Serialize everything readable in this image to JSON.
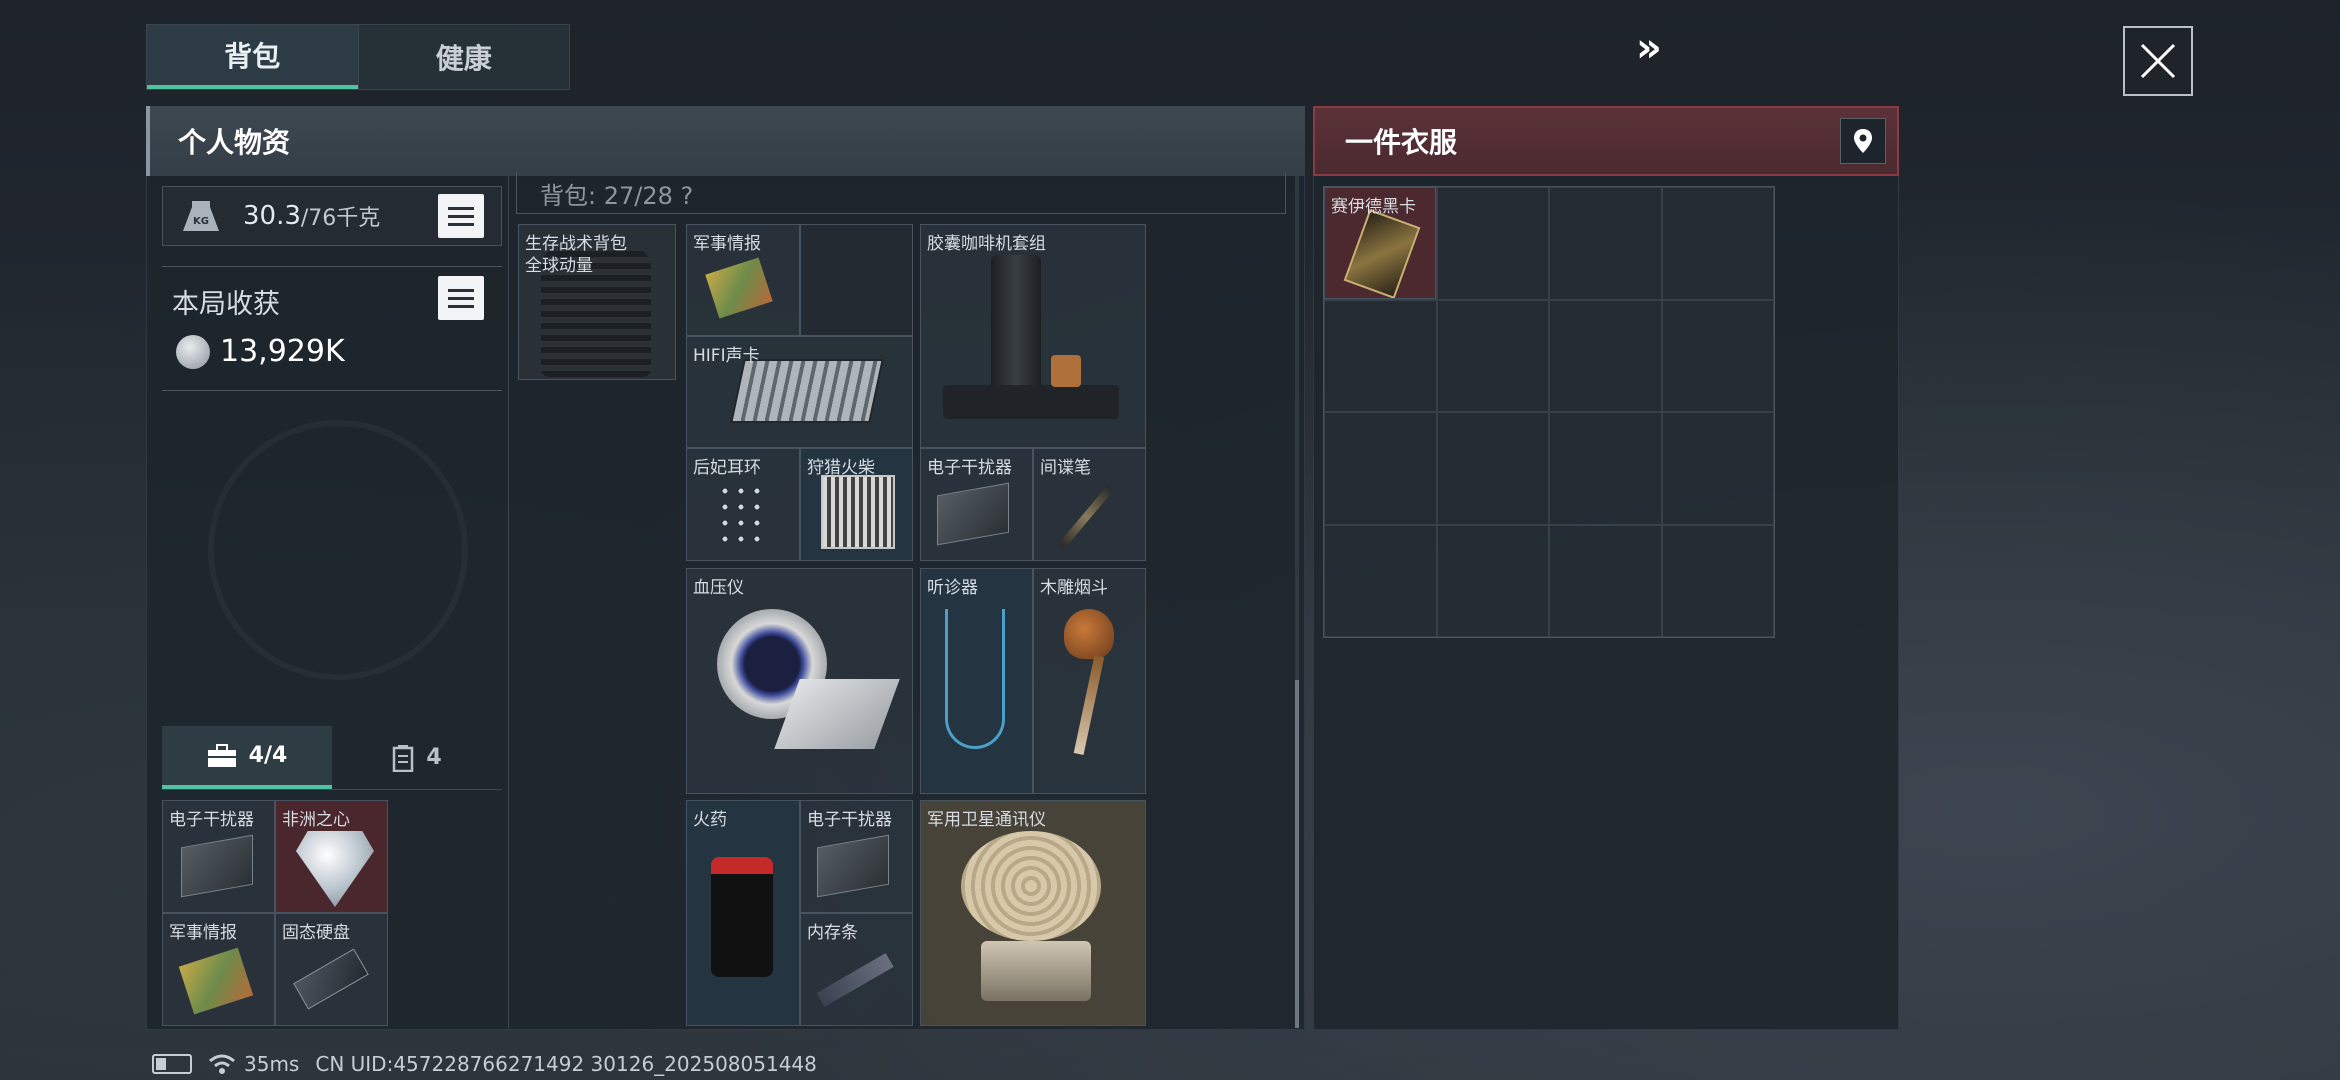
{
  "tabs": {
    "backpack": "背包",
    "health": "健康"
  },
  "left_panel": {
    "title": "个人物资",
    "weight": {
      "current": "30.3",
      "max": "/76千克",
      "icon_label": "KG"
    },
    "harvest": {
      "label": "本局收获",
      "value": "13,929K"
    },
    "pouch_tabs": [
      {
        "icon": "briefcase-icon",
        "label": "4/4"
      },
      {
        "icon": "canister-icon",
        "label": "4"
      }
    ],
    "pouch_items": [
      "电子干扰器",
      "非洲之心",
      "军事情报",
      "固态硬盘"
    ]
  },
  "backpack": {
    "capacity_label": "背包: 27/28 ?",
    "bag_name": "生存战术背包",
    "bag_subtitle": "全球动量",
    "items": [
      "军事情报",
      "胶囊咖啡机套组",
      "HIFI声卡",
      "后妃耳环",
      "狩猎火柴",
      "电子干扰器",
      "间谍笔",
      "血压仪",
      "听诊器",
      "木雕烟斗",
      "火药",
      "电子干扰器",
      "军用卫星通讯仪",
      "内存条"
    ]
  },
  "right_panel": {
    "title": "一件衣服",
    "items": [
      "赛伊德黑卡"
    ]
  },
  "status_bar": {
    "ping": "35ms",
    "uid": "CN UID:457228766271492 30126_202508051448"
  },
  "colors": {
    "accent": "#4fc39f",
    "danger": "#8c3a44"
  }
}
